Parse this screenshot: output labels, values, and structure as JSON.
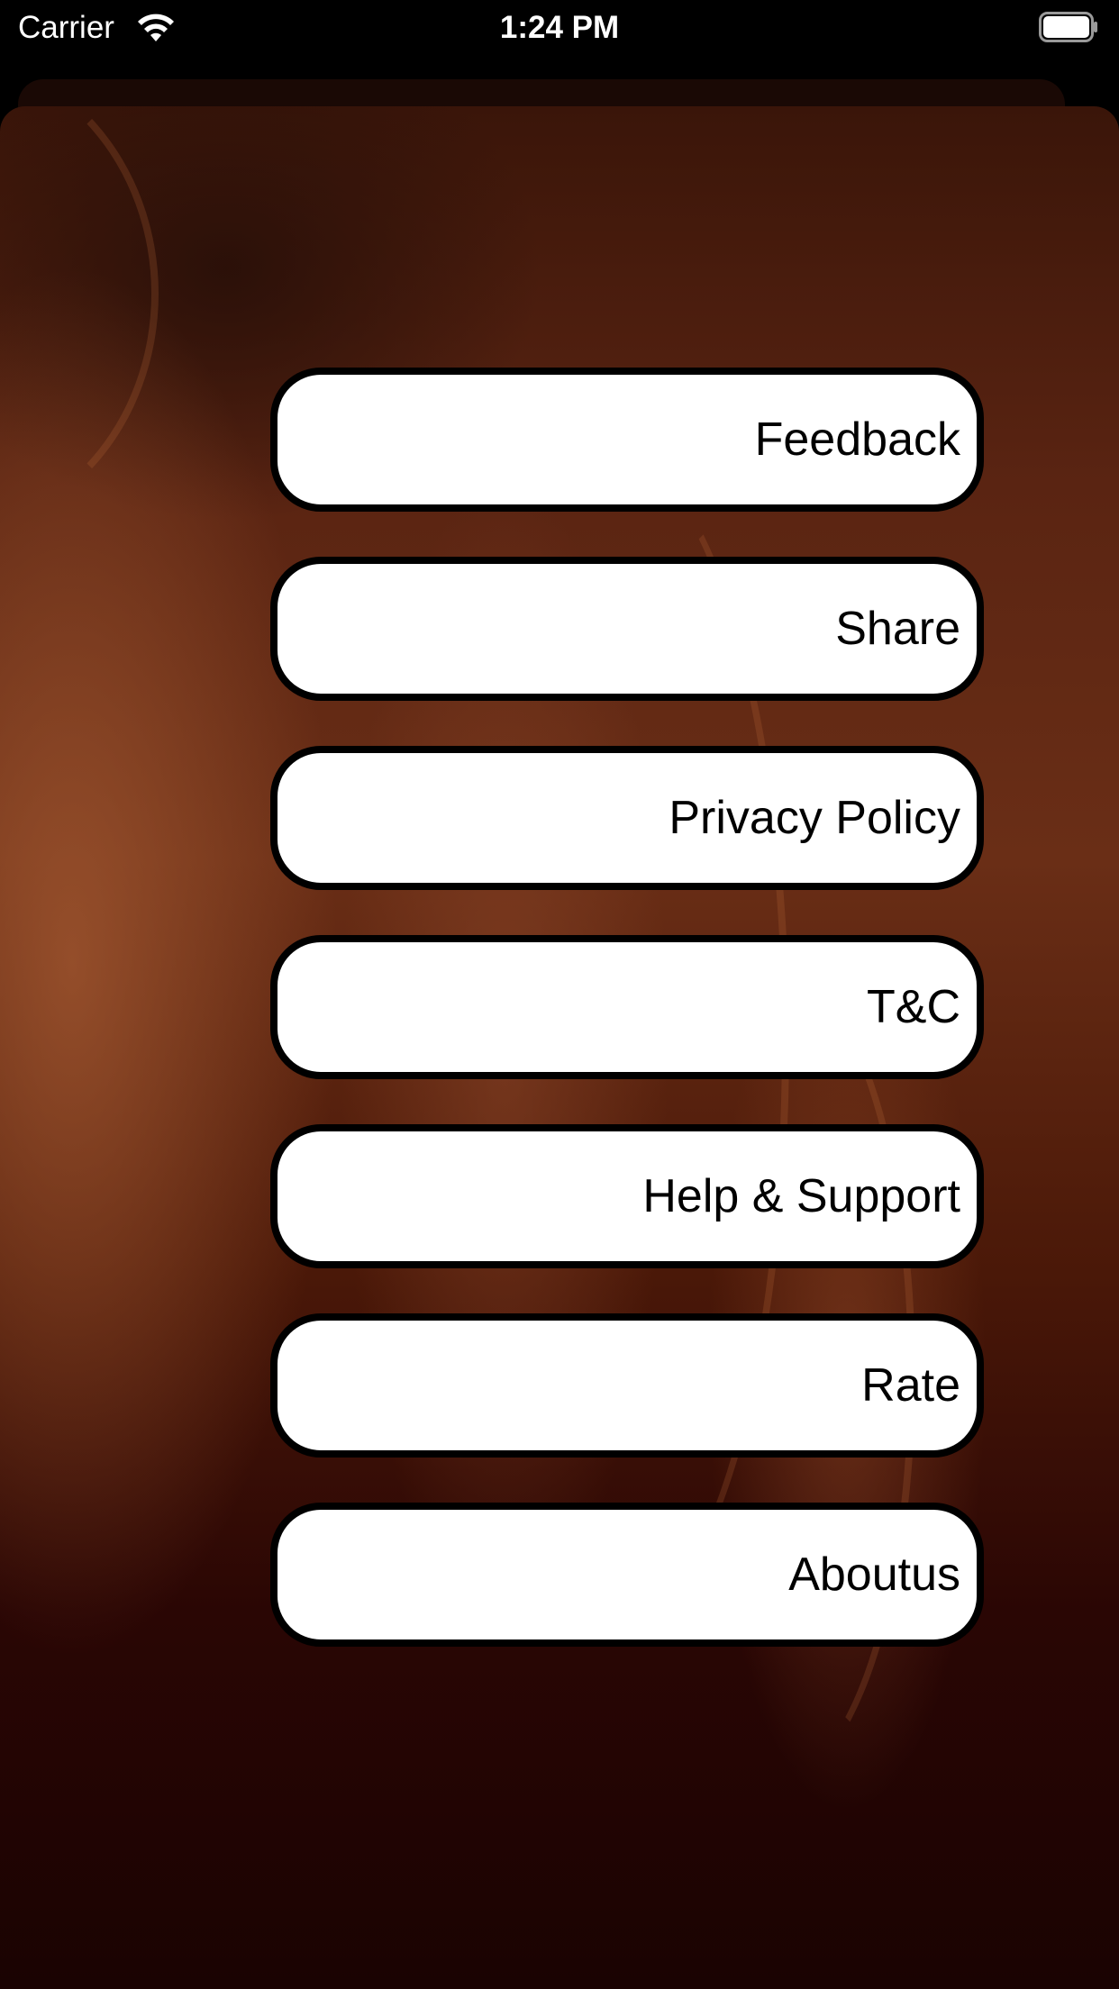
{
  "status_bar": {
    "carrier": "Carrier",
    "time": "1:24 PM",
    "wifi_icon": "wifi-icon",
    "battery_icon": "battery-icon"
  },
  "menu": {
    "items": [
      {
        "label": "Feedback"
      },
      {
        "label": "Share"
      },
      {
        "label": "Privacy Policy"
      },
      {
        "label": "T&C"
      },
      {
        "label": "Help & Support"
      },
      {
        "label": "Rate"
      },
      {
        "label": "Aboutus"
      }
    ]
  },
  "colors": {
    "button_background": "#ffffff",
    "button_border": "#000000",
    "background_tone": "#5a2412"
  }
}
